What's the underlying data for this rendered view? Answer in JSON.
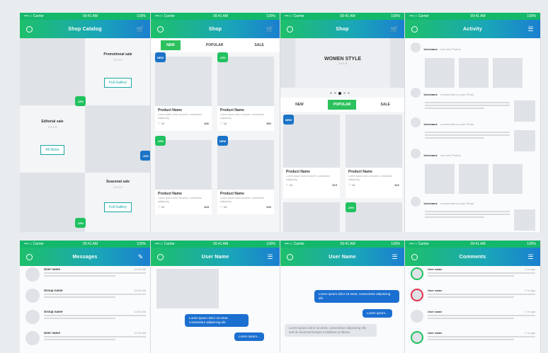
{
  "status": {
    "carrier": "•••○○ Carrier",
    "time": "09:41 AM",
    "battery": "100%"
  },
  "colors": {
    "green": "#20c15f",
    "blue": "#1b73c7",
    "accent": "#1aa7a3"
  },
  "catalog": {
    "title": "Shop Catalog",
    "promo1": {
      "title": "Promotional sale",
      "year": "2 0 1 5",
      "button": "Full Gallery"
    },
    "promo2": {
      "title": "Editorial sale",
      "year": "2 0 1 5",
      "button": "All Items"
    },
    "promo3": {
      "title": "Seasonal sale",
      "year": "2 0 1 5",
      "button": "Full Gallery"
    },
    "badge": "-15%"
  },
  "shop": {
    "title": "Shop",
    "tabs": [
      "NEW",
      "POPULAR",
      "SALE"
    ],
    "badge_new": "NEW",
    "badge_sale": "-15%",
    "products": [
      {
        "name": "Product Name",
        "desc": "Lorem ipsum dolor sit amet, consectetur adipiscing",
        "likes": "12",
        "price": "$36"
      },
      {
        "name": "Product Name",
        "desc": "Lorem ipsum dolor sit amet, consectetur adipiscing",
        "likes": "14",
        "price": "$50"
      },
      {
        "name": "Product Name",
        "desc": "Lorem ipsum dolor sit amet, consectetur adipiscing",
        "likes": "12",
        "price": "$28"
      },
      {
        "name": "Product Name",
        "desc": "Lorem ipsum dolor sit amet, consectetur adipiscing",
        "likes": "14",
        "price": "$40"
      }
    ]
  },
  "shop2": {
    "title": "Shop",
    "hero_title": "WOMEN STYLE",
    "hero_year": "2 0 1 5",
    "tabs": [
      "NEW",
      "POPULAR",
      "SALE"
    ],
    "products": [
      {
        "name": "Product Name",
        "desc": "Lorem ipsum dolor sit amet, consectetur adipiscing",
        "likes": "12",
        "price": "$15"
      },
      {
        "name": "Product Name",
        "desc": "Lorem ipsum dolor sit amet, consectetur adipiscing",
        "likes": "14",
        "price": "$22"
      }
    ]
  },
  "activity": {
    "title": "Activity",
    "items": [
      {
        "user": "Username",
        "action": "has new Photos"
      },
      {
        "user": "Username",
        "action": "commented on your Photo"
      },
      {
        "user": "Username",
        "action": "commented on your Photo"
      },
      {
        "user": "Username",
        "action": "has new Photos"
      },
      {
        "user": "Username",
        "action": "commented on your Photo"
      }
    ]
  },
  "messages": {
    "title": "Messages",
    "items": [
      {
        "name": "User name",
        "time": "12:30 AM"
      },
      {
        "name": "Group name",
        "time": "12:30 AM"
      },
      {
        "name": "Group name",
        "time": "12:30 AM"
      },
      {
        "name": "User name",
        "time": "12:30 AM"
      }
    ]
  },
  "chat1": {
    "title": "User Name",
    "bubbles": [
      "Lorem ipsum dolor sit amet, consectetur adipiscing elit.",
      "Lorem ipsum..."
    ]
  },
  "chat2": {
    "title": "User Name",
    "bubbles": [
      "Lorem ipsum dolor sit amet, consectetur adipiscing elit.",
      "Lorem ipsum...",
      "Lorem ipsum dolor sit amet, consectetur adipiscing elit, sed do eiusmod tempor incididunt ut labore."
    ]
  },
  "comments": {
    "title": "Comments",
    "items": [
      {
        "name": "User name",
        "time": "1 hr ago"
      },
      {
        "name": "User name",
        "time": "1 hr ago"
      },
      {
        "name": "User name",
        "time": "1 hr ago"
      },
      {
        "name": "User name",
        "time": "1 hr ago"
      }
    ]
  }
}
